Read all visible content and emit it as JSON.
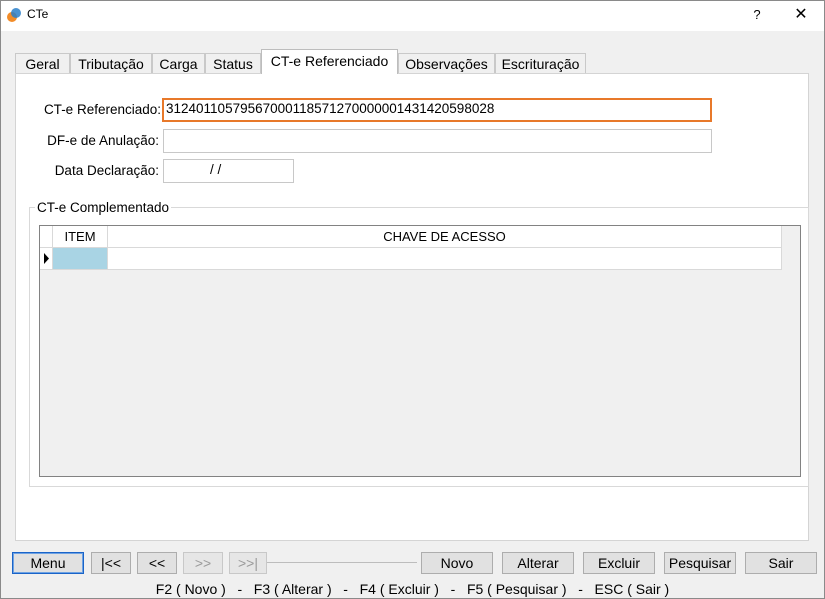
{
  "window": {
    "title": "CTe",
    "help": "?",
    "close": "✕"
  },
  "tabs": [
    "Geral",
    "Tributação",
    "Carga",
    "Status",
    "CT-e Referenciado",
    "Observações",
    "Escrituração"
  ],
  "form": {
    "cte_ref_label": "CT-e Referenciado:",
    "cte_ref_value": "31240110579567000118571270000001431420598028",
    "dfe_label": "DF-e de Anulação:",
    "dfe_value": "",
    "data_label": "Data Declaração:",
    "data_value": "/  /"
  },
  "group": {
    "title": "CT-e Complementado",
    "columns": [
      "ITEM",
      "CHAVE DE ACESSO"
    ]
  },
  "buttons": {
    "menu": "Menu",
    "first": "|<<",
    "prev": "<<",
    "next": ">>",
    "last": ">>|",
    "novo": "Novo",
    "alterar": "Alterar",
    "excluir": "Excluir",
    "pesquisar": "Pesquisar",
    "sair": "Sair"
  },
  "status": "F2 ( Novo )   -   F3 ( Alterar )   -   F4 ( Excluir )   -   F5 ( Pesquisar )   -   ESC ( Sair )",
  "colors": {
    "accent": "#e8792a",
    "selection": "#a9d4e4",
    "default_button": "#1a64c8"
  },
  "icons": {
    "app": "cte-app-icon",
    "row_indicator": "row-pointer-icon"
  }
}
